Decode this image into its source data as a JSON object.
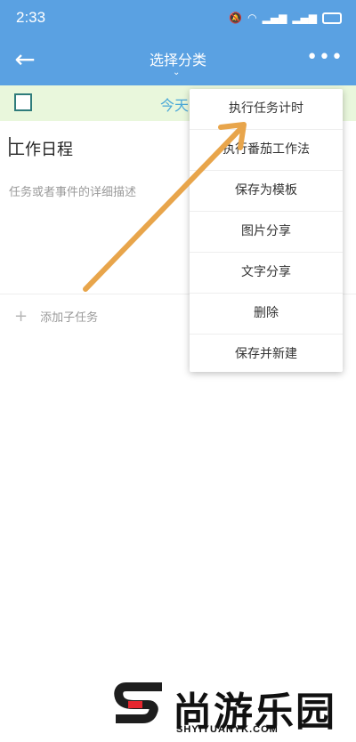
{
  "status_bar": {
    "time": "2:33",
    "icons": [
      "mute-icon",
      "wifi-icon",
      "signal-icon",
      "signal-icon",
      "battery-icon"
    ]
  },
  "app_bar": {
    "title": "选择分类",
    "back_icon": "back-arrow-icon",
    "more_icon": "more-icon"
  },
  "date_band": {
    "label": "今天"
  },
  "task": {
    "title": "工作日程",
    "description_placeholder": "任务或者事件的详细描述",
    "add_subtask_label": "添加子任务"
  },
  "menu": {
    "items": [
      "执行任务计时",
      "执行番茄工作法",
      "保存为模板",
      "图片分享",
      "文字分享",
      "删除",
      "保存并新建"
    ]
  },
  "watermark": {
    "cn": "尚游乐园",
    "en": "SHYIYUANYK.COM"
  },
  "colors": {
    "header": "#5aa1e2",
    "date_band": "#e9f7dc",
    "arrow": "#e8a54b",
    "today": "#4aa8d8"
  }
}
